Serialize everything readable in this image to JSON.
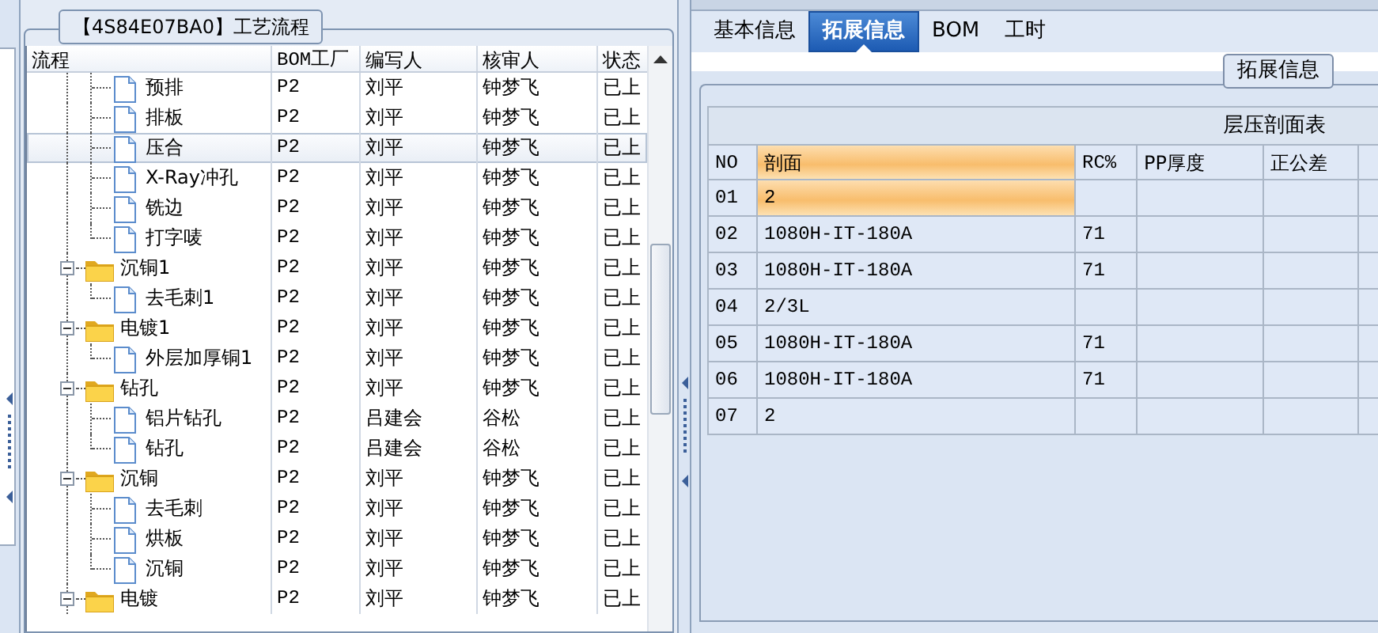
{
  "process_panel": {
    "title": "【4S84E07BA0】工艺流程",
    "columns": [
      "流程",
      "BOM工厂",
      "编写人",
      "核审人",
      "状态"
    ],
    "rows": [
      {
        "children": [
          {
            "kind": "file",
            "label": "预排",
            "cells": [
              "P2",
              "刘平",
              "钟梦飞",
              "已上"
            ],
            "selected": false
          },
          {
            "kind": "file",
            "label": "排板",
            "cells": [
              "P2",
              "刘平",
              "钟梦飞",
              "已上"
            ],
            "selected": false
          },
          {
            "kind": "file",
            "label": "压合",
            "cells": [
              "P2",
              "刘平",
              "钟梦飞",
              "已上"
            ],
            "selected": true
          },
          {
            "kind": "file",
            "label": "X-Ray冲孔",
            "cells": [
              "P2",
              "刘平",
              "钟梦飞",
              "已上"
            ],
            "selected": false
          },
          {
            "kind": "file",
            "label": "铣边",
            "cells": [
              "P2",
              "刘平",
              "钟梦飞",
              "已上"
            ],
            "selected": false
          },
          {
            "kind": "file",
            "label": "打字唛",
            "cells": [
              "P2",
              "刘平",
              "钟梦飞",
              "已上"
            ],
            "selected": false
          }
        ]
      },
      {
        "kind": "folder",
        "label": "沉铜1",
        "cells": [
          "P2",
          "刘平",
          "钟梦飞",
          "已上"
        ],
        "selected": false,
        "expanded": true,
        "children": [
          {
            "kind": "file",
            "label": "去毛刺1",
            "cells": [
              "P2",
              "刘平",
              "钟梦飞",
              "已上"
            ],
            "selected": false
          }
        ]
      },
      {
        "kind": "folder",
        "label": "电镀1",
        "cells": [
          "P2",
          "刘平",
          "钟梦飞",
          "已上"
        ],
        "selected": false,
        "expanded": true,
        "children": [
          {
            "kind": "file",
            "label": "外层加厚铜1",
            "cells": [
              "P2",
              "刘平",
              "钟梦飞",
              "已上"
            ],
            "selected": false
          }
        ]
      },
      {
        "kind": "folder",
        "label": "钻孔",
        "cells": [
          "P2",
          "刘平",
          "钟梦飞",
          "已上"
        ],
        "selected": false,
        "expanded": true,
        "children": [
          {
            "kind": "file",
            "label": "铝片钻孔",
            "cells": [
              "P2",
              "吕建会",
              "谷松",
              "已上"
            ],
            "selected": false
          },
          {
            "kind": "file",
            "label": "钻孔",
            "cells": [
              "P2",
              "吕建会",
              "谷松",
              "已上"
            ],
            "selected": false
          }
        ]
      },
      {
        "kind": "folder",
        "label": "沉铜",
        "cells": [
          "P2",
          "刘平",
          "钟梦飞",
          "已上"
        ],
        "selected": false,
        "expanded": true,
        "children": [
          {
            "kind": "file",
            "label": "去毛刺",
            "cells": [
              "P2",
              "刘平",
              "钟梦飞",
              "已上"
            ],
            "selected": false
          },
          {
            "kind": "file",
            "label": "烘板",
            "cells": [
              "P2",
              "刘平",
              "钟梦飞",
              "已上"
            ],
            "selected": false
          },
          {
            "kind": "file",
            "label": "沉铜",
            "cells": [
              "P2",
              "刘平",
              "钟梦飞",
              "已上"
            ],
            "selected": false
          }
        ]
      },
      {
        "kind": "folder",
        "label": "电镀",
        "cells": [
          "P2",
          "刘平",
          "钟梦飞",
          "已上"
        ],
        "selected": false,
        "expanded": true
      }
    ]
  },
  "tabs": [
    {
      "label": "基本信息",
      "selected": false
    },
    {
      "label": "拓展信息",
      "selected": true
    },
    {
      "label": "BOM",
      "selected": false
    },
    {
      "label": "工时",
      "selected": false
    }
  ],
  "group_title": "拓展信息",
  "lamination_table": {
    "title": "层压剖面表",
    "columns": [
      {
        "label": "NO",
        "active": false
      },
      {
        "label": "剖面",
        "active": true
      },
      {
        "label": "RC%",
        "active": false
      },
      {
        "label": "PP厚度",
        "active": false
      },
      {
        "label": "正公差",
        "active": false
      }
    ],
    "rows": [
      {
        "cells": [
          "01",
          "2"
        ],
        "selected": true
      },
      {
        "cells": [
          "02",
          "1080H-IT-180A",
          "71"
        ],
        "selected": false
      },
      {
        "cells": [
          "03",
          "1080H-IT-180A",
          "71"
        ],
        "selected": false
      },
      {
        "cells": [
          "04",
          "2/3L"
        ],
        "selected": false
      },
      {
        "cells": [
          "05",
          "1080H-IT-180A",
          "71"
        ],
        "selected": false
      },
      {
        "cells": [
          "06",
          "1080H-IT-180A",
          "71"
        ],
        "selected": false
      },
      {
        "cells": [
          "07",
          "2"
        ],
        "selected": false
      }
    ]
  }
}
